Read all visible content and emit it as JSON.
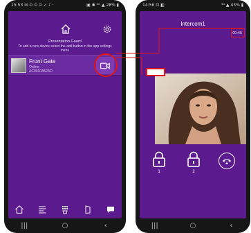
{
  "left_phone": {
    "status_bar": {
      "left": "15:53 ✉ ⊙ ⊙ ⊙ ✓ ♪ ·",
      "right": "▣ ✱ ⁴ᴳ ▲ 28% ▮"
    },
    "guard": {
      "title": "Presentation Guard",
      "text": "To add a new device select the add button in the app settings menu"
    },
    "device": {
      "name": "Front Gate",
      "status": "Online",
      "id": "AC0010A52AD"
    },
    "icons": [
      "home-icon",
      "settings-icon",
      "video-call-icon",
      "log-icon",
      "keypad-icon",
      "unlock-icon",
      "message-icon"
    ],
    "nav": [
      "|||",
      "○",
      "‹"
    ]
  },
  "right_phone": {
    "status_bar": {
      "left": "14:56 ⊡ ◧",
      "right": "⁴ᴳ ▲ 43% ▮"
    },
    "title": "Intercom1",
    "timer": "00:45",
    "doors": [
      {
        "label": "1"
      },
      {
        "label": "2"
      }
    ],
    "nav": [
      "|||",
      "○",
      "‹"
    ]
  },
  "colors": {
    "app_bg": "#5b1a8d",
    "card_bg": "#6a2aa0",
    "highlight": "#e01515",
    "text": "#ffffff"
  }
}
